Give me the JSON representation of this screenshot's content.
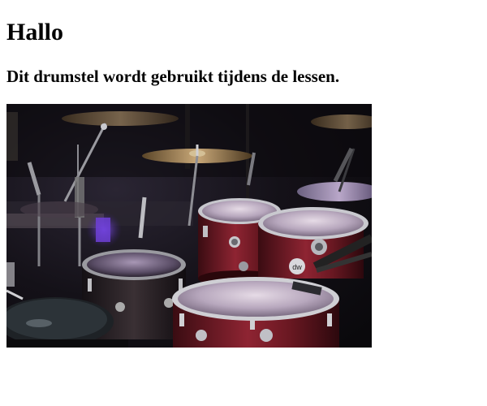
{
  "page": {
    "heading": "Hallo",
    "subheading": "Dit drumstel wordt gebruikt tijdens de lessen."
  },
  "image": {
    "subject": "drum-kit-photo",
    "drum_badge": "dw"
  }
}
